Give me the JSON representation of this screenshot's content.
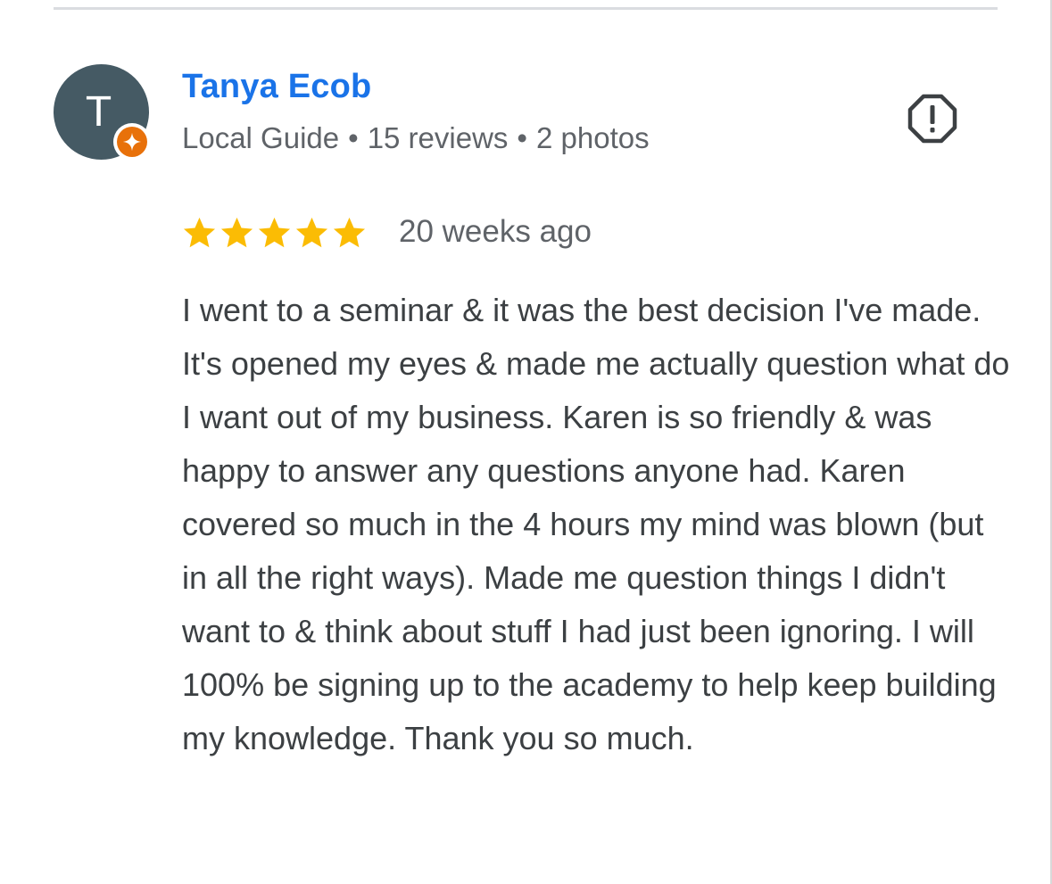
{
  "review": {
    "reviewer": {
      "initial": "T",
      "name": "Tanya Ecob",
      "badge": "Local Guide",
      "reviews_count": "15 reviews",
      "photos_count": "2 photos",
      "separator": "•",
      "avatar_color": "#455a64",
      "badge_color": "#e8710a"
    },
    "rating": {
      "stars": 5,
      "max_stars": 5,
      "star_color": "#fbbc04"
    },
    "date": "20 weeks ago",
    "text": "I went to a seminar & it was the best decision I've made. It's opened my eyes & made me actually question what do I want out of my business. Karen is so friendly & was happy to answer any questions anyone had. Karen covered so much in the 4 hours my mind was blown (but in all the right ways). Made me question things I didn't want to & think about stuff I had just been ignoring. I will 100% be signing up to the academy to help keep building my knowledge. Thank you so much.",
    "report_icon": "report-icon"
  },
  "colors": {
    "name_link": "#1a73e8",
    "meta_text": "#5f6368",
    "body_text": "#3c4043",
    "divider": "#dadce0"
  }
}
